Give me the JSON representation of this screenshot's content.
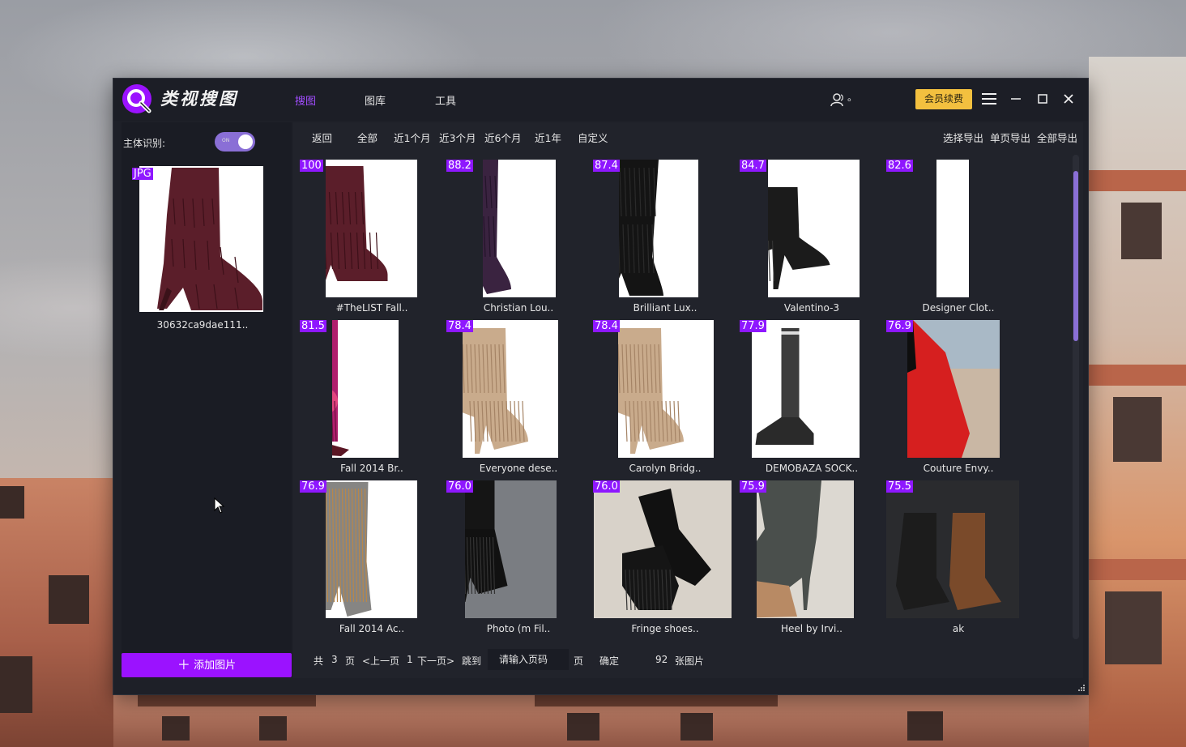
{
  "app": {
    "title": "类视搜图",
    "nav": [
      {
        "label": "搜图",
        "active": true
      },
      {
        "label": "图库",
        "active": false
      },
      {
        "label": "工具",
        "active": false
      }
    ],
    "user_label": "。",
    "vip_label": "会员续费",
    "accent_color": "#9b12ff"
  },
  "left_panel": {
    "subject_label": "主体识别:",
    "toggle_on": true,
    "query_badge": "JPG",
    "query_name": "30632ca9dae111..",
    "add_label": "添加图片",
    "add_icon": "plus-icon"
  },
  "filters": [
    "返回",
    "全部",
    "近1个月",
    "近3个月",
    "近6个月",
    "近1年",
    "自定义"
  ],
  "exports": [
    "选择导出",
    "单页导出",
    "全部导出"
  ],
  "results": [
    {
      "score": "100",
      "caption": "#TheLIST Fall..",
      "kind": "fringe-maroon"
    },
    {
      "score": "88.2",
      "caption": "Christian Lou..",
      "kind": "fringe-plum-tall"
    },
    {
      "score": "87.4",
      "caption": "Brilliant Lux..",
      "kind": "fringe-black-tall"
    },
    {
      "score": "84.7",
      "caption": "Valentino-3",
      "kind": "bootie-black"
    },
    {
      "score": "82.6",
      "caption": "Designer Clot..",
      "kind": "strip-collage"
    },
    {
      "score": "81.5",
      "caption": "Fall 2014 Br..",
      "kind": "fringe-pink"
    },
    {
      "score": "78.4",
      "caption": "Everyone dese..",
      "kind": "fringe-beige"
    },
    {
      "score": "78.4",
      "caption": "Carolyn Bridg..",
      "kind": "fringe-beige"
    },
    {
      "score": "77.9",
      "caption": "DEMOBAZA SOCK..",
      "kind": "sock-boot"
    },
    {
      "score": "76.9",
      "caption": "Couture Envy..",
      "kind": "red-pump"
    },
    {
      "score": "76.9",
      "caption": "Fall 2014 Ac..",
      "kind": "fringe-grey"
    },
    {
      "score": "76.0",
      "caption": "Photo (m Fil..",
      "kind": "street-fringe"
    },
    {
      "score": "76.0",
      "caption": "Fringe shoes..",
      "kind": "black-fringe-heels"
    },
    {
      "score": "75.9",
      "caption": "Heel by Irvi..",
      "kind": "wrap-heel"
    },
    {
      "score": "75.5",
      "caption": "ak",
      "kind": "tassel-pair"
    }
  ],
  "pager": {
    "total_prefix": "共",
    "total_pages": "3",
    "page_unit": "页",
    "prev": "<上一页",
    "current": "1",
    "next": "下一页>",
    "jump_label": "跳到",
    "input_placeholder": "请输入页码",
    "page_suffix": "页",
    "confirm": "确定",
    "image_count": "92",
    "image_unit": "张图片"
  }
}
